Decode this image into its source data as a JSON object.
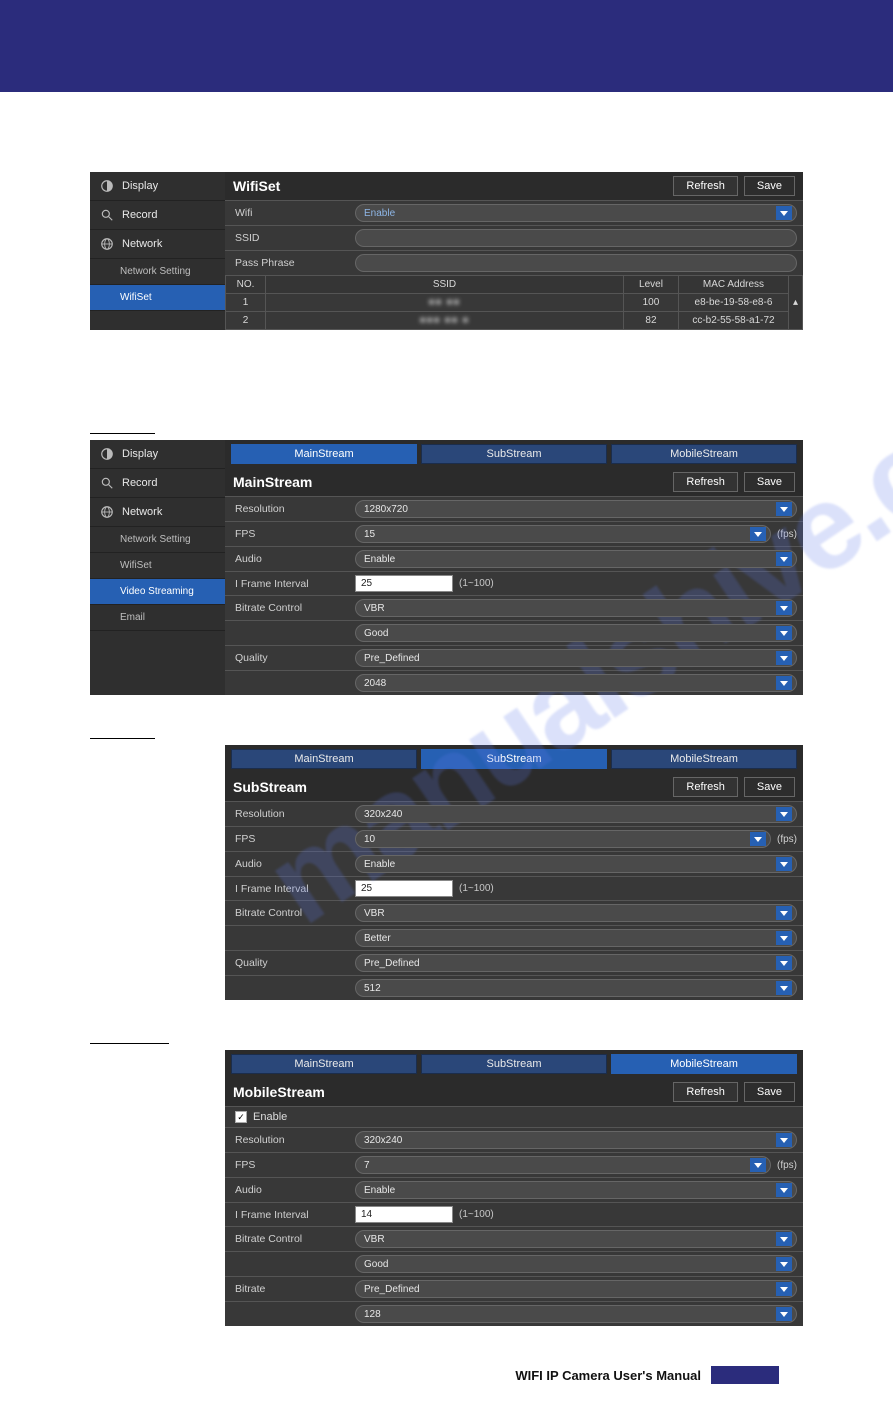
{
  "footer": {
    "manual": "WIFI IP Camera User's Manual"
  },
  "buttons": {
    "refresh": "Refresh",
    "save": "Save"
  },
  "sidebar": {
    "display": "Display",
    "record": "Record",
    "network": "Network",
    "network_setting": "Network Setting",
    "wifiset": "WifiSet",
    "video_streaming": "Video Streaming",
    "email": "Email"
  },
  "tabs": {
    "main": "MainStream",
    "sub": "SubStream",
    "mobile": "MobileStream"
  },
  "labels": {
    "wifi": "Wifi",
    "ssid": "SSID",
    "pass": "Pass Phrase",
    "no": "NO.",
    "ssid_col": "SSID",
    "level": "Level",
    "mac": "MAC Address",
    "resolution": "Resolution",
    "fps": "FPS",
    "audio": "Audio",
    "iframe": "I Frame Interval",
    "bitrate_control": "Bitrate Control",
    "quality": "Quality",
    "bitrate": "Bitrate",
    "enable": "Enable"
  },
  "wifiset": {
    "title": "WifiSet",
    "wifi_value": "Enable",
    "ssid_value": "",
    "pass_value": "",
    "rows": [
      {
        "no": "1",
        "ssid": "■■ ■■",
        "level": "100",
        "mac": "e8-be-19-58-e8-6"
      },
      {
        "no": "2",
        "ssid": "■■■ ■■ ■",
        "level": "82",
        "mac": "cc-b2-55-58-a1-72"
      }
    ]
  },
  "mainstream": {
    "title": "MainStream",
    "resolution": "1280x720",
    "fps": "15",
    "fps_unit": "(fps)",
    "audio": "Enable",
    "iframe": "25",
    "iframe_hint": "(1~100)",
    "bitrate_control": "VBR",
    "quality_preset": "Good",
    "quality": "Pre_Defined",
    "bitrate": "2048"
  },
  "substream": {
    "title": "SubStream",
    "resolution": "320x240",
    "fps": "10",
    "fps_unit": "(fps)",
    "audio": "Enable",
    "iframe": "25",
    "iframe_hint": "(1~100)",
    "bitrate_control": "VBR",
    "quality_preset": "Better",
    "quality": "Pre_Defined",
    "bitrate": "512"
  },
  "mobilestream": {
    "title": "MobileStream",
    "enable_checked": true,
    "resolution": "320x240",
    "fps": "7",
    "fps_unit": "(fps)",
    "audio": "Enable",
    "iframe": "14",
    "iframe_hint": "(1~100)",
    "bitrate_control": "VBR",
    "quality_preset": "Good",
    "quality": "Pre_Defined",
    "bitrate": "128"
  },
  "section_titles": {
    "main": "",
    "sub": "",
    "mobile": ""
  },
  "watermark": "manualshive.com"
}
